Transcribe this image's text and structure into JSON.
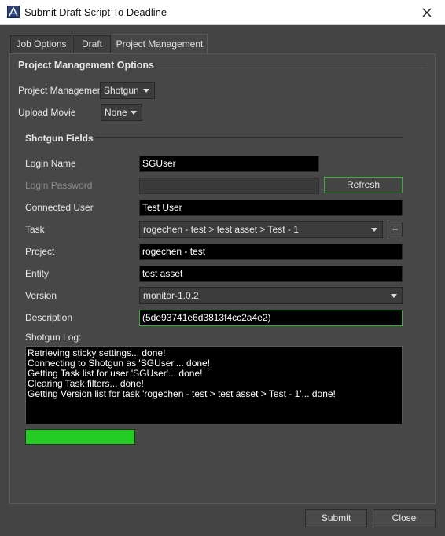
{
  "window": {
    "title": "Submit Draft Script To Deadline"
  },
  "tabs": [
    {
      "label": "Job Options",
      "active": false
    },
    {
      "label": "Draft",
      "active": false
    },
    {
      "label": "Project Management",
      "active": true
    }
  ],
  "pm_options": {
    "heading": "Project Management Options",
    "project_management_label": "Project Management",
    "project_management_value": "Shotgun",
    "upload_movie_label": "Upload Movie",
    "upload_movie_value": "None"
  },
  "shotgun": {
    "heading": "Shotgun Fields",
    "login_name_label": "Login Name",
    "login_name_value": "SGUser",
    "login_password_label": "Login Password",
    "login_password_value": "",
    "refresh_label": "Refresh",
    "connected_user_label": "Connected User",
    "connected_user_value": "Test User",
    "task_label": "Task",
    "task_value": "rogechen - test > test asset > Test - 1",
    "add_task_label": "+",
    "project_label": "Project",
    "project_value": "rogechen - test",
    "entity_label": "Entity",
    "entity_value": "test asset",
    "version_label": "Version",
    "version_value": "monitor-1.0.2",
    "description_label": "Description",
    "description_value": "(5de93741e6d3813f4cc2a4e2)",
    "log_label": "Shotgun Log:",
    "log_lines": [
      "Retrieving sticky settings... done!",
      "Connecting to Shotgun as 'SGUser'... done!",
      "Getting Task list for user 'SGUser'... done!",
      "Clearing Task filters... done!",
      "Getting Version list for task 'rogechen - test > test asset > Test - 1'... done!"
    ],
    "progress_fraction": 1.0,
    "progress_color": "#22cc22"
  },
  "footer": {
    "submit_label": "Submit",
    "close_label": "Close"
  },
  "colors": {
    "background": "#444444",
    "field_background": "#000000",
    "focus_border": "#3dab3d"
  }
}
